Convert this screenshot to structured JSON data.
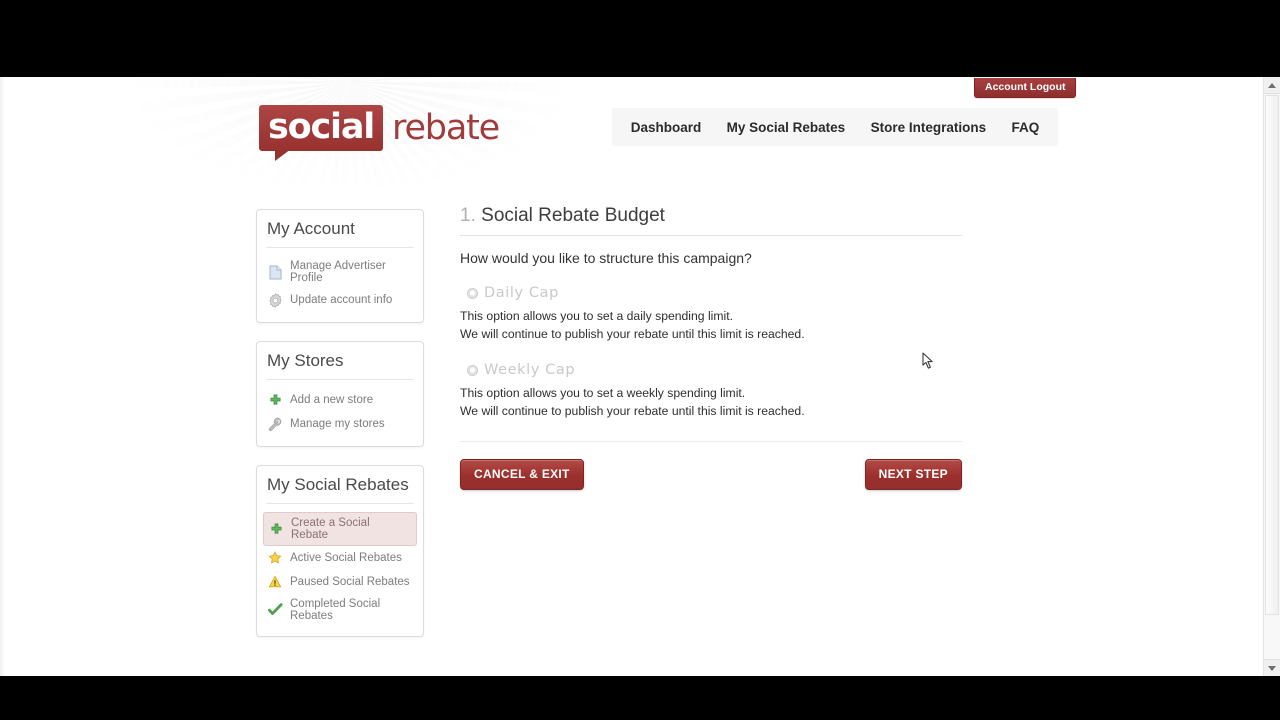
{
  "brand": {
    "logo_word1": "social",
    "logo_word2": "rebate",
    "accent_red": "#9c2f2c",
    "logo_bubble_red": "#a33c3c"
  },
  "topbar": {
    "logout_label": "Account Logout"
  },
  "nav": {
    "items": [
      {
        "label": "Dashboard"
      },
      {
        "label": "My Social Rebates"
      },
      {
        "label": "Store Integrations"
      },
      {
        "label": "FAQ"
      }
    ]
  },
  "sidebar": {
    "panels": [
      {
        "title": "My Account",
        "items": [
          {
            "label": "Manage Advertiser Profile",
            "icon": "document-icon",
            "active": false
          },
          {
            "label": "Update account info",
            "icon": "gear-icon",
            "active": false
          }
        ]
      },
      {
        "title": "My Stores",
        "items": [
          {
            "label": "Add a new store",
            "icon": "plus-icon",
            "active": false
          },
          {
            "label": "Manage my stores",
            "icon": "wrench-icon",
            "active": false
          }
        ]
      },
      {
        "title": "My Social Rebates",
        "items": [
          {
            "label": "Create a Social Rebate",
            "icon": "plus-icon",
            "active": true
          },
          {
            "label": "Active Social Rebates",
            "icon": "star-icon",
            "active": false
          },
          {
            "label": "Paused Social Rebates",
            "icon": "warning-icon",
            "active": false
          },
          {
            "label": "Completed Social Rebates",
            "icon": "check-icon",
            "active": false
          }
        ]
      }
    ]
  },
  "main": {
    "step_number": "1.",
    "title": "Social Rebate Budget",
    "question": "How would you like to structure this campaign?",
    "options": [
      {
        "label": "Daily Cap",
        "selected": false,
        "desc_line1": "This option allows you to set a daily spending limit.",
        "desc_line2": "We will continue to publish your rebate until this limit is reached."
      },
      {
        "label": "Weekly Cap",
        "selected": false,
        "desc_line1": "This option allows you to set a weekly spending limit.",
        "desc_line2": "We will continue to publish your rebate until this limit is reached."
      }
    ],
    "cancel_label": "CANCEL & EXIT",
    "next_label": "NEXT STEP"
  }
}
